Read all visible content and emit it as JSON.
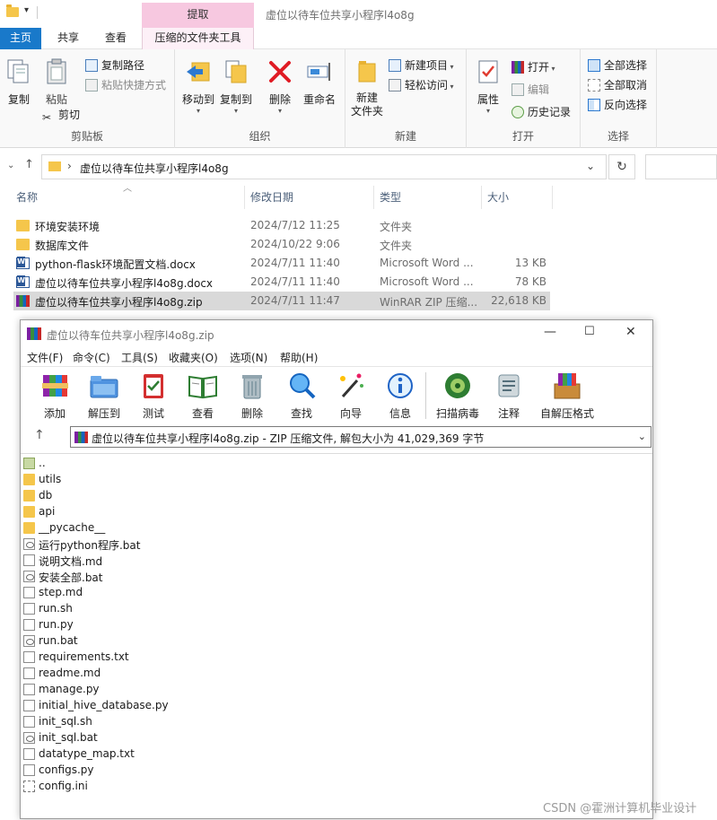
{
  "titlebar": {
    "context_tab": "提取",
    "window_title": "虚位以待车位共享小程序l4o8g"
  },
  "ribbon_tabs": [
    {
      "label": "主页"
    },
    {
      "label": "共享"
    },
    {
      "label": "查看"
    },
    {
      "label": "压缩的文件夹工具"
    }
  ],
  "ribbon": {
    "clipboard": {
      "copy": "复制",
      "paste": "粘贴",
      "copy_path": "复制路径",
      "paste_shortcut": "粘贴快捷方式",
      "cut": "剪切",
      "label": "剪贴板"
    },
    "organize": {
      "move_to": "移动到",
      "copy_to": "复制到",
      "delete": "删除",
      "rename": "重命名",
      "label": "组织"
    },
    "new": {
      "new_folder": "新建\n文件夹",
      "new_item": "新建项目",
      "easy_access": "轻松访问",
      "label": "新建"
    },
    "open": {
      "properties": "属性",
      "open": "打开",
      "edit": "编辑",
      "history": "历史记录",
      "label": "打开"
    },
    "select": {
      "select_all": "全部选择",
      "select_none": "全部取消",
      "invert": "反向选择",
      "label": "选择"
    }
  },
  "address": {
    "path": "虚位以待车位共享小程序l4o8g"
  },
  "columns": {
    "name": "名称",
    "date": "修改日期",
    "type": "类型",
    "size": "大小"
  },
  "files": [
    {
      "name": "环境安装环境",
      "date": "2024/7/12 11:25",
      "type": "文件夹",
      "size": "",
      "icon": "folder-icon"
    },
    {
      "name": "数据库文件",
      "date": "2024/10/22 9:06",
      "type": "文件夹",
      "size": "",
      "icon": "folder-icon"
    },
    {
      "name": "python-flask环境配置文档.docx",
      "date": "2024/7/11 11:40",
      "type": "Microsoft Word ...",
      "size": "13 KB",
      "icon": "word-icon"
    },
    {
      "name": "虚位以待车位共享小程序l4o8g.docx",
      "date": "2024/7/11 11:40",
      "type": "Microsoft Word ...",
      "size": "78 KB",
      "icon": "word-icon"
    },
    {
      "name": "虚位以待车位共享小程序l4o8g.zip",
      "date": "2024/7/11 11:47",
      "type": "WinRAR ZIP 压缩...",
      "size": "22,618 KB",
      "icon": "winrar-icon"
    }
  ],
  "winrar": {
    "title": "虚位以待车位共享小程序l4o8g.zip",
    "menu": [
      "文件(F)",
      "命令(C)",
      "工具(S)",
      "收藏夹(O)",
      "选项(N)",
      "帮助(H)"
    ],
    "toolbar": [
      "添加",
      "解压到",
      "测试",
      "查看",
      "删除",
      "查找",
      "向导",
      "信息",
      "扫描病毒",
      "注释",
      "自解压格式"
    ],
    "path": "虚位以待车位共享小程序l4o8g.zip - ZIP 压缩文件, 解包大小为 41,029,369 字节",
    "entries": [
      {
        "name": "..",
        "icon": "up-folder-icon"
      },
      {
        "name": "utils",
        "icon": "folder-icon"
      },
      {
        "name": "db",
        "icon": "folder-icon"
      },
      {
        "name": "api",
        "icon": "folder-icon"
      },
      {
        "name": "__pycache__",
        "icon": "folder-icon"
      },
      {
        "name": "运行python程序.bat",
        "icon": "bat-icon"
      },
      {
        "name": "说明文档.md",
        "icon": "file-icon"
      },
      {
        "name": "安装全部.bat",
        "icon": "bat-icon"
      },
      {
        "name": "step.md",
        "icon": "file-icon"
      },
      {
        "name": "run.sh",
        "icon": "file-icon"
      },
      {
        "name": "run.py",
        "icon": "file-icon"
      },
      {
        "name": "run.bat",
        "icon": "bat-icon"
      },
      {
        "name": "requirements.txt",
        "icon": "file-icon"
      },
      {
        "name": "readme.md",
        "icon": "file-icon"
      },
      {
        "name": "manage.py",
        "icon": "file-icon"
      },
      {
        "name": "initial_hive_database.py",
        "icon": "file-icon"
      },
      {
        "name": "init_sql.sh",
        "icon": "file-icon"
      },
      {
        "name": "init_sql.bat",
        "icon": "bat-icon"
      },
      {
        "name": "datatype_map.txt",
        "icon": "file-icon"
      },
      {
        "name": "configs.py",
        "icon": "file-icon"
      },
      {
        "name": "config.ini",
        "icon": "ini-icon"
      }
    ]
  },
  "watermark": "CSDN @霍洲计算机毕业设计"
}
